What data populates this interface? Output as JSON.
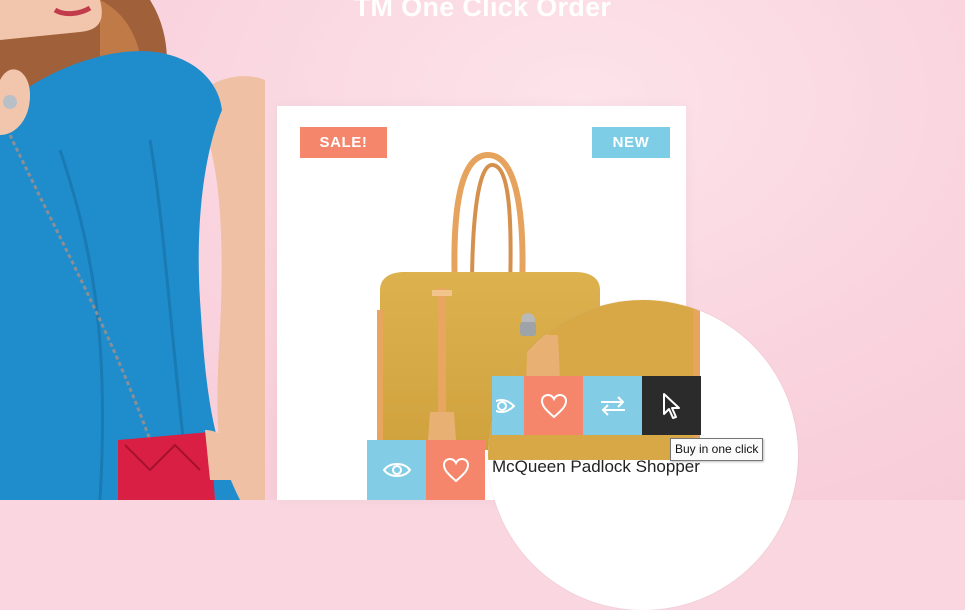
{
  "page": {
    "title": "TM One Click Order"
  },
  "product": {
    "badge_sale": "SALE!",
    "badge_new": "NEW",
    "name": "McQueen Padlock Shopper"
  },
  "actions": [
    {
      "name": "quick-view",
      "icon": "eye-icon"
    },
    {
      "name": "wishlist",
      "icon": "heart-icon"
    },
    {
      "name": "compare",
      "icon": "swap-arrows-icon"
    },
    {
      "name": "buy-in-one-click",
      "icon": "cursor-icon"
    }
  ],
  "tooltip": {
    "text": "Buy in one click"
  },
  "colors": {
    "background": "#fad6e0",
    "sale": "#f5866b",
    "new": "#7ecde6",
    "button_blue": "#82cce6",
    "button_coral": "#f5866b",
    "button_dark": "#2b2b2b"
  }
}
